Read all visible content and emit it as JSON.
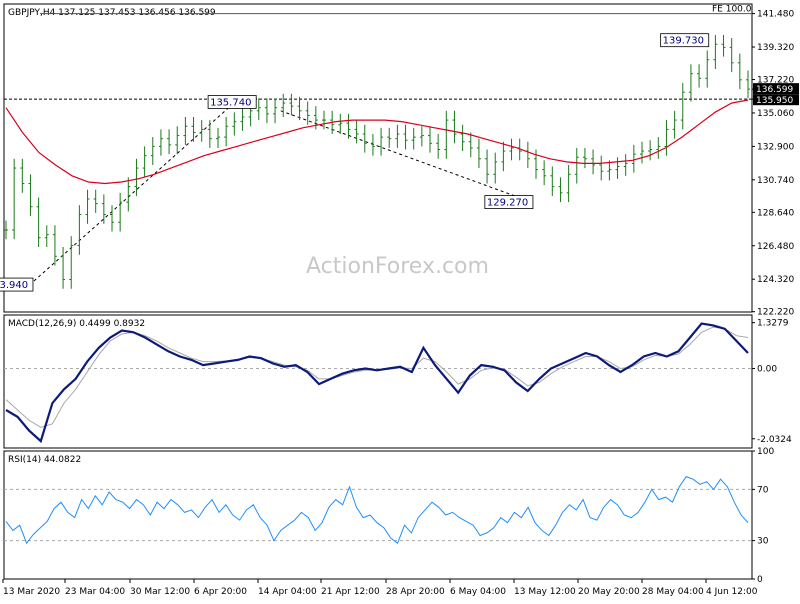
{
  "chart_data": [
    {
      "type": "candlestick",
      "title": "GBPJPY,H4  137.125 137.453 136.456 136.599",
      "watermark": "ActionForex.com",
      "ylim": [
        122.2,
        142.1
      ],
      "y_ticks": [
        "141.480",
        "139.320",
        "137.220",
        "136.599",
        "135.950",
        "135.060",
        "132.900",
        "130.740",
        "128.640",
        "126.480",
        "124.320",
        "122.220"
      ],
      "last_price": {
        "value": 136.599,
        "label": "136.599"
      },
      "support_line": {
        "value": 135.95,
        "label": "135.950"
      },
      "fe_level": {
        "value": 141.48,
        "label": "FE 100.0"
      },
      "price_series": [
        127.5,
        131.5,
        130.5,
        129.0,
        127.0,
        127.2,
        125.8,
        124.3,
        126.5,
        128.5,
        129.5,
        129.2,
        128.5,
        128.0,
        129.3,
        130.3,
        131.5,
        132.3,
        132.9,
        133.4,
        133.0,
        133.6,
        134.2,
        133.8,
        134.0,
        133.4,
        133.5,
        134.2,
        134.5,
        134.8,
        135.2,
        135.4,
        135.0,
        135.4,
        135.7,
        135.5,
        135.2,
        134.9,
        134.6,
        134.6,
        134.3,
        134.4,
        134.0,
        133.7,
        133.1,
        132.9,
        133.5,
        133.4,
        133.7,
        133.3,
        133.5,
        133.6,
        133.1,
        132.7,
        134.6,
        133.7,
        133.2,
        132.8,
        132.1,
        131.1,
        131.9,
        132.6,
        132.8,
        132.6,
        132.1,
        131.4,
        131.0,
        130.3,
        129.9,
        131.1,
        132.2,
        132.1,
        131.7,
        131.3,
        131.4,
        131.6,
        131.8,
        132.4,
        132.6,
        132.7,
        132.9,
        134.0,
        134.6,
        136.4,
        137.6,
        137.3,
        138.5,
        139.5,
        139.3,
        138.3,
        137.2,
        136.6
      ],
      "ema_series": [
        135.4,
        133.8,
        132.5,
        131.7,
        131.0,
        130.6,
        130.5,
        130.6,
        130.8,
        131.1,
        131.5,
        131.9,
        132.3,
        132.6,
        132.9,
        133.2,
        133.5,
        133.8,
        134.1,
        134.3,
        134.5,
        134.6,
        134.6,
        134.6,
        134.5,
        134.3,
        134.1,
        133.9,
        133.7,
        133.4,
        133.1,
        132.8,
        132.4,
        132.1,
        131.9,
        131.8,
        131.8,
        131.9,
        132.0,
        132.3,
        132.8,
        133.5,
        134.3,
        135.1,
        135.7,
        135.9
      ],
      "ema_span": [
        0.0,
        1.0
      ],
      "annotations": [
        {
          "label": "3.940",
          "x": 0.015,
          "price": 123.94
        },
        {
          "label": "135.740",
          "x": 0.305,
          "price": 135.74
        },
        {
          "label": "129.270",
          "x": 0.675,
          "price": 129.27
        },
        {
          "label": "139.730",
          "x": 0.91,
          "price": 139.73
        }
      ],
      "trendline": [
        {
          "x": 0.04,
          "price": 124.2
        },
        {
          "x": 0.305,
          "price": 135.6
        }
      ],
      "channel_line": [
        {
          "x": 0.37,
          "price": 135.2
        },
        {
          "x": 0.7,
          "price": 129.4
        }
      ]
    },
    {
      "type": "line",
      "title": "MACD(12,26,9) 0.4499 0.8932",
      "ylim": [
        -2.3,
        1.55
      ],
      "y_ticks": [
        "1.3279",
        "0.00",
        "-2.0324"
      ],
      "zero_line": 0,
      "macd_series": [
        -1.2,
        -1.4,
        -1.8,
        -2.1,
        -1.0,
        -0.6,
        -0.3,
        0.2,
        0.6,
        0.9,
        1.1,
        1.05,
        0.9,
        0.7,
        0.5,
        0.35,
        0.25,
        0.1,
        0.15,
        0.2,
        0.25,
        0.35,
        0.3,
        0.15,
        0.05,
        0.1,
        -0.1,
        -0.45,
        -0.3,
        -0.15,
        -0.05,
        0.0,
        -0.05,
        0.0,
        0.05,
        -0.1,
        0.6,
        0.1,
        -0.3,
        -0.7,
        -0.2,
        0.1,
        0.05,
        -0.05,
        -0.4,
        -0.65,
        -0.3,
        0.0,
        0.15,
        0.3,
        0.45,
        0.35,
        0.1,
        -0.1,
        0.1,
        0.35,
        0.45,
        0.35,
        0.5,
        0.9,
        1.3,
        1.25,
        1.15,
        0.8,
        0.45
      ],
      "signal_series": [
        -0.9,
        -1.2,
        -1.5,
        -1.7,
        -1.6,
        -1.0,
        -0.6,
        -0.1,
        0.4,
        0.8,
        1.0,
        1.05,
        0.95,
        0.8,
        0.6,
        0.45,
        0.3,
        0.2,
        0.2,
        0.22,
        0.26,
        0.32,
        0.3,
        0.2,
        0.1,
        0.05,
        -0.05,
        -0.3,
        -0.3,
        -0.2,
        -0.1,
        -0.05,
        -0.03,
        -0.02,
        0.02,
        0.0,
        0.3,
        0.2,
        -0.1,
        -0.45,
        -0.3,
        -0.05,
        0.02,
        -0.02,
        -0.25,
        -0.5,
        -0.4,
        -0.15,
        0.05,
        0.2,
        0.35,
        0.35,
        0.2,
        0.0,
        0.05,
        0.25,
        0.38,
        0.35,
        0.42,
        0.7,
        1.05,
        1.2,
        1.15,
        0.95,
        0.9
      ]
    },
    {
      "type": "line",
      "title": "RSI(14) 44.0822",
      "ylim": [
        0,
        100
      ],
      "y_ticks": [
        "100",
        "70",
        "30",
        "0"
      ],
      "levels": [
        70,
        30
      ],
      "rsi_series": [
        45,
        38,
        42,
        28,
        35,
        40,
        45,
        55,
        60,
        52,
        48,
        62,
        55,
        65,
        58,
        68,
        62,
        60,
        55,
        62,
        58,
        50,
        60,
        55,
        62,
        58,
        52,
        54,
        48,
        56,
        62,
        52,
        58,
        50,
        46,
        54,
        58,
        48,
        42,
        30,
        38,
        42,
        46,
        52,
        48,
        38,
        44,
        56,
        62,
        58,
        72,
        56,
        48,
        50,
        44,
        40,
        32,
        28,
        42,
        36,
        48,
        54,
        60,
        56,
        50,
        52,
        48,
        45,
        42,
        34,
        36,
        40,
        48,
        44,
        52,
        48,
        56,
        44,
        38,
        34,
        42,
        52,
        58,
        54,
        62,
        48,
        46,
        56,
        62,
        58,
        50,
        48,
        52,
        60,
        70,
        62,
        64,
        60,
        72,
        80,
        78,
        74,
        76,
        70,
        78,
        72,
        60,
        50,
        44
      ]
    }
  ],
  "x_axis_labels": [
    "13 Mar 2020",
    "23 Mar 04:00",
    "30 Mar 12:00",
    "6 Apr 20:00",
    "14 Apr 04:00",
    "21 Apr 12:00",
    "28 Apr 20:00",
    "6 May 04:00",
    "13 May 12:00",
    "20 May 20:00",
    "28 May 04:00",
    "4 Jun 12:00"
  ],
  "colors": {
    "ema": "#d9001e",
    "macd": "#0c1a7a",
    "signal": "#a8a8a8",
    "rsi": "#1e8fff",
    "candle": "#1a7a1a",
    "grid": "#aaaaaa",
    "text": "#000000"
  }
}
